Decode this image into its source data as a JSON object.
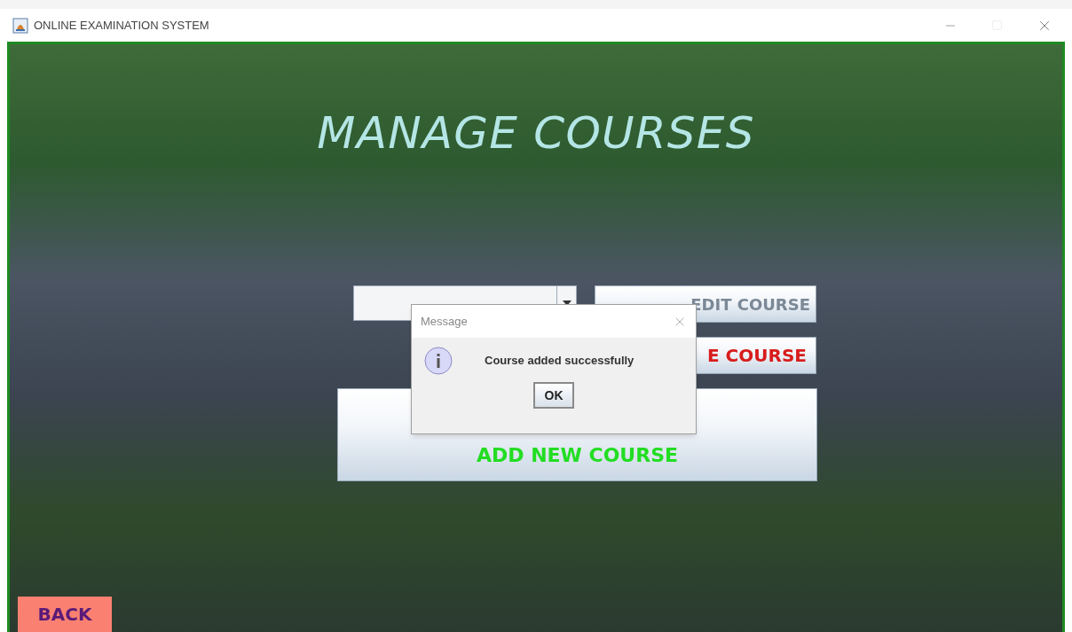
{
  "window": {
    "title": "ONLINE EXAMINATION SYSTEM"
  },
  "heading": "MANAGE COURSES",
  "actions": [
    {
      "label": "EDIT COURSE",
      "color": "#7b8896"
    },
    {
      "label": "E COURSE",
      "color": "#d81c1c"
    },
    {
      "label": "ADD NEW COURSE",
      "color": "#22dd22"
    }
  ],
  "dialog": {
    "title": "Message",
    "message": "Course added successfully",
    "button": "OK"
  },
  "back_button": "BACK"
}
